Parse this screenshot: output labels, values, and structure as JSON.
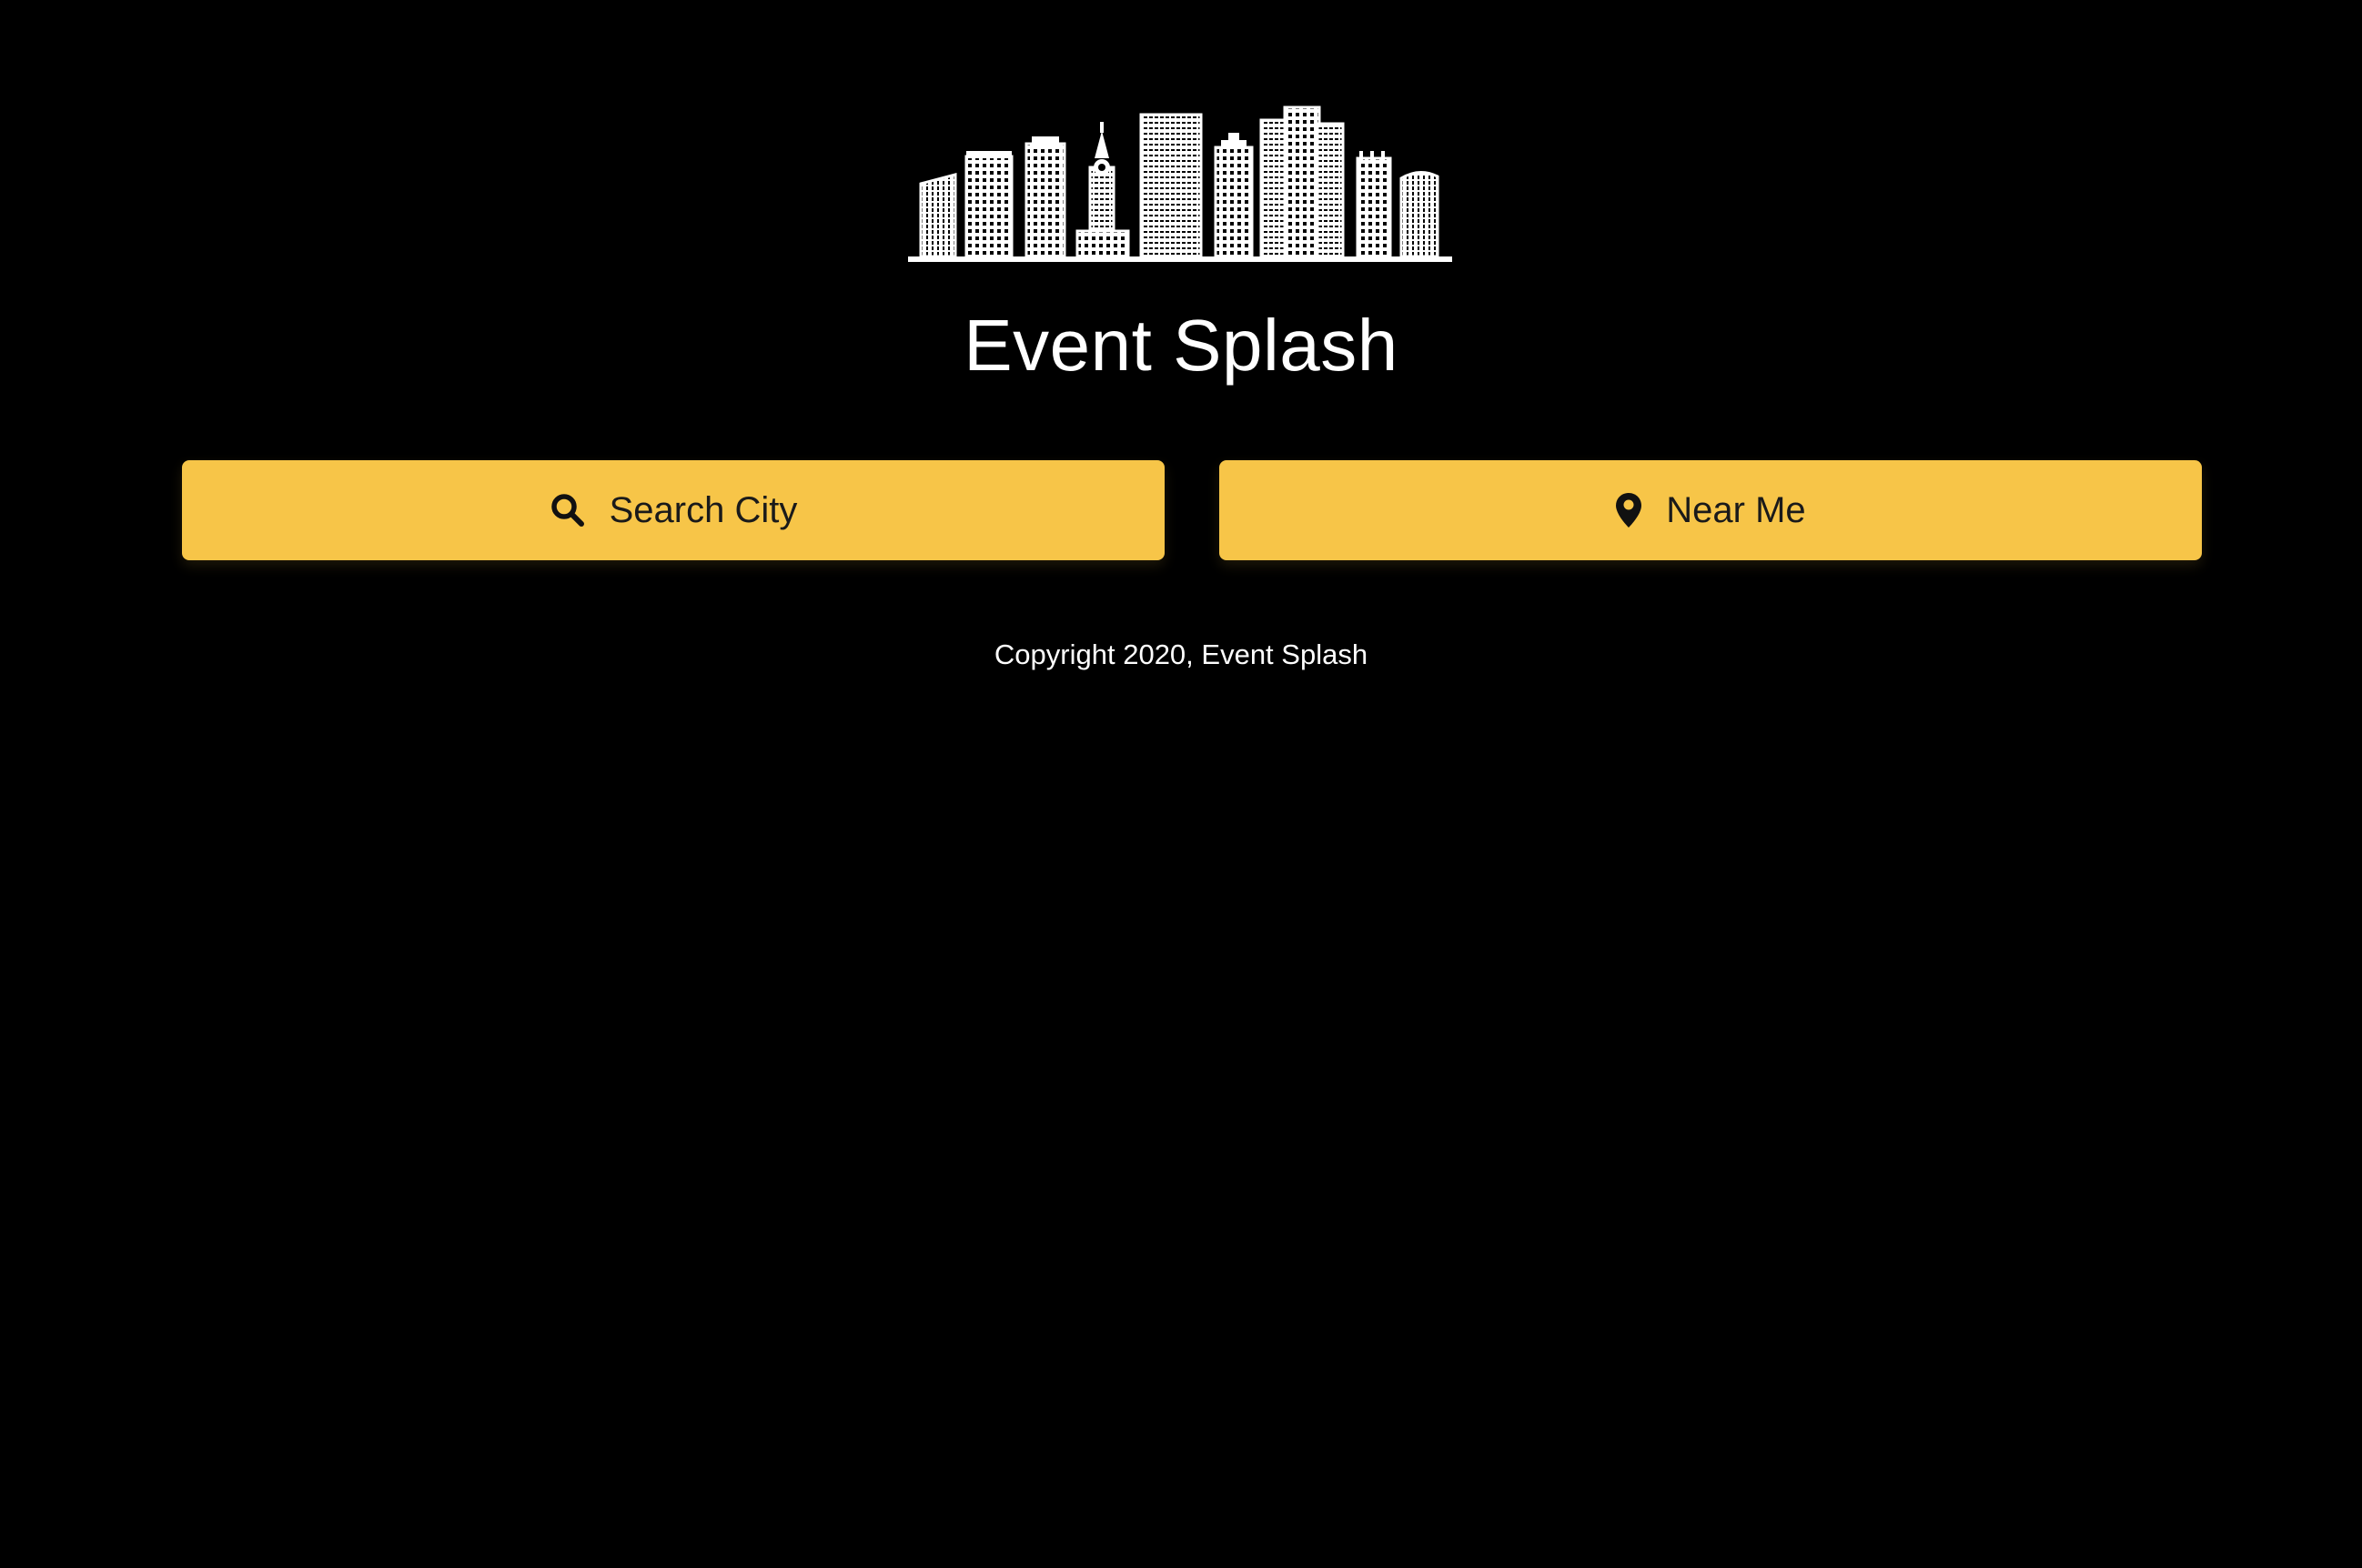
{
  "app": {
    "title": "Event Splash",
    "logo_icon": "city-skyline-icon"
  },
  "actions": {
    "search_city": {
      "label": "Search City",
      "icon": "search-icon"
    },
    "near_me": {
      "label": "Near Me",
      "icon": "map-pin-icon"
    }
  },
  "footer": {
    "copyright": "Copyright 2020, Event Splash"
  },
  "colors": {
    "background": "#000000",
    "accent": "#f7c548",
    "text": "#ffffff",
    "button_text": "#1a1a1a"
  }
}
